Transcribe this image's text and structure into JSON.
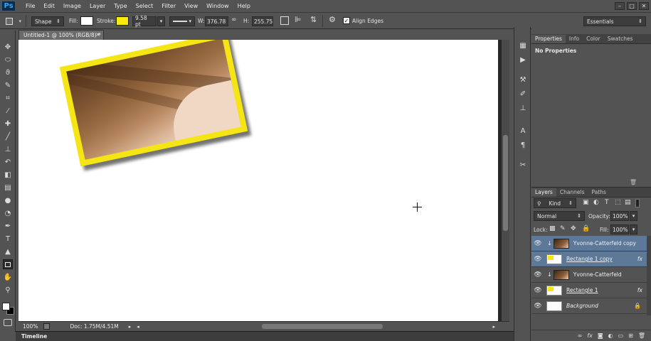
{
  "menubar": {
    "logo": "Ps",
    "items": [
      "File",
      "Edit",
      "Image",
      "Layer",
      "Type",
      "Select",
      "Filter",
      "View",
      "Window",
      "Help"
    ],
    "window_buttons": [
      "–",
      "□",
      "✕"
    ]
  },
  "options": {
    "mode": "Shape",
    "fill_label": "Fill:",
    "stroke_label": "Stroke:",
    "stroke_width": "9.58 pt",
    "w_label": "W:",
    "w_value": "376.78",
    "h_label": "H:",
    "h_value": "255.75",
    "align_edges_label": "Align Edges",
    "workspace": "Essentials",
    "fill_color": "#ffffff",
    "stroke_color": "#f7ea0c"
  },
  "document": {
    "tab_title": "Untitled-1 @ 100% (RGB/8) *",
    "tab_close": "×",
    "photo_frame_color": "#f5e514"
  },
  "status": {
    "zoom": "100%",
    "doc_info": "Doc: 1.75M/4.51M"
  },
  "timeline": {
    "label": "Timeline"
  },
  "properties": {
    "tabs": [
      "Properties",
      "Info",
      "Color",
      "Swatches"
    ],
    "empty_text": "No Properties"
  },
  "layers": {
    "tabs": [
      "Layers",
      "Channels",
      "Paths"
    ],
    "kind_label": "Kind",
    "blend_mode": "Normal",
    "opacity_label": "Opacity:",
    "opacity_value": "100%",
    "lock_label": "Lock:",
    "fill_label": "Fill:",
    "fill_value": "100%",
    "fx_label": "fx",
    "rows": [
      {
        "name": "Yvonne-Catterfeld copy",
        "selected": true
      },
      {
        "name": "Rectangle 1 copy",
        "selected": true
      },
      {
        "name": "Yvonne-Catterfeld",
        "selected": false
      },
      {
        "name": "Rectangle 1",
        "selected": false
      },
      {
        "name": "Background",
        "selected": false
      }
    ]
  }
}
